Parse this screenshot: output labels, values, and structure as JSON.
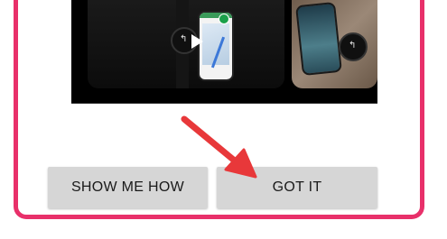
{
  "buttons": {
    "show_me_how": "SHOW ME HOW",
    "got_it": "GOT IT"
  },
  "preview": {
    "cards": [
      {
        "type": "video",
        "has_play_button": true
      },
      {
        "type": "image"
      }
    ]
  },
  "colors": {
    "frame_border": "#e8306a",
    "annotation_arrow": "#e8383a",
    "button_bg": "#d6d6d6",
    "strip_bg": "#000000"
  },
  "icons": {
    "play": "play-icon",
    "watch_back": "back-arrow-icon",
    "annotation": "annotation-arrow"
  }
}
